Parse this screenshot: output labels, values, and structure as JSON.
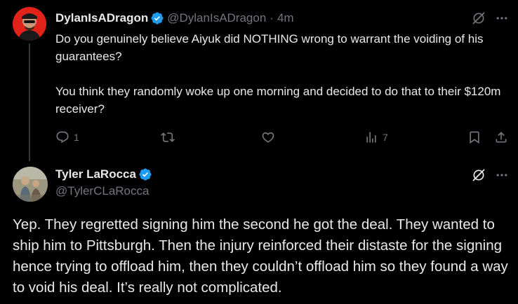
{
  "tweet1": {
    "display_name": "DylanIsADragon",
    "handle": "@DylanIsADragon",
    "separator": "·",
    "time": "4m",
    "text_para1": "Do you genuinely believe Aiyuk did NOTHING wrong to warrant the voiding of his guarantees?",
    "text_para2": "You think they randomly woke up one morning and decided to do that to their $120m receiver?",
    "reply_count": "1",
    "retweet_count": "",
    "like_count": "",
    "view_count": "7"
  },
  "tweet2": {
    "display_name": "Tyler LaRocca",
    "handle": "@TylerCLaRocca",
    "text": "Yep. They regretted signing him the second he got the deal. They wanted to ship him to Pittsburgh. Then the injury reinforced their distaste for the signing hence trying to offload him, then they couldn’t offload him so they found a way to void his deal. It’s really not complicated."
  },
  "colors": {
    "background": "#000000",
    "text_primary": "#e7e9ea",
    "text_secondary": "#71767b",
    "verified_blue": "#1d9bf0",
    "thread_line": "#333639"
  },
  "icons": [
    "verified-badge-icon",
    "grok-icon",
    "more-icon",
    "reply-icon",
    "retweet-icon",
    "like-icon",
    "views-icon",
    "bookmark-icon",
    "share-icon"
  ]
}
